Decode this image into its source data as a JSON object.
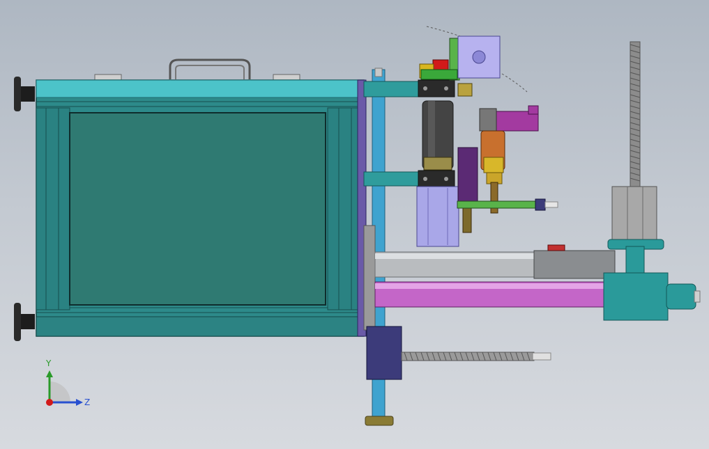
{
  "viewport": {
    "background_top": "#aeb7c2",
    "background_bottom": "#d7dadf"
  },
  "colors": {
    "frame_teal": "#2d8a8a",
    "frame_cyan": "#4cc3c9",
    "panel": "#2f7a72",
    "rail_blue": "#3fa3cf",
    "purple_plate": "#6a5aa8",
    "magenta_rod": "#c466c8",
    "gray_rod": "#b9bcbf",
    "motor_lavender": "#a9a7e8",
    "stepper_lilac": "#b7b2ef",
    "green_bar": "#59b34a",
    "dark_navy": "#3c3b7a",
    "bracket_magenta": "#a33aa0",
    "red_accent": "#d21a1a",
    "copper": "#c8702e"
  },
  "triad": {
    "y_label": "Y",
    "z_label": "Z",
    "icon": "coordinate-triad-icon"
  }
}
